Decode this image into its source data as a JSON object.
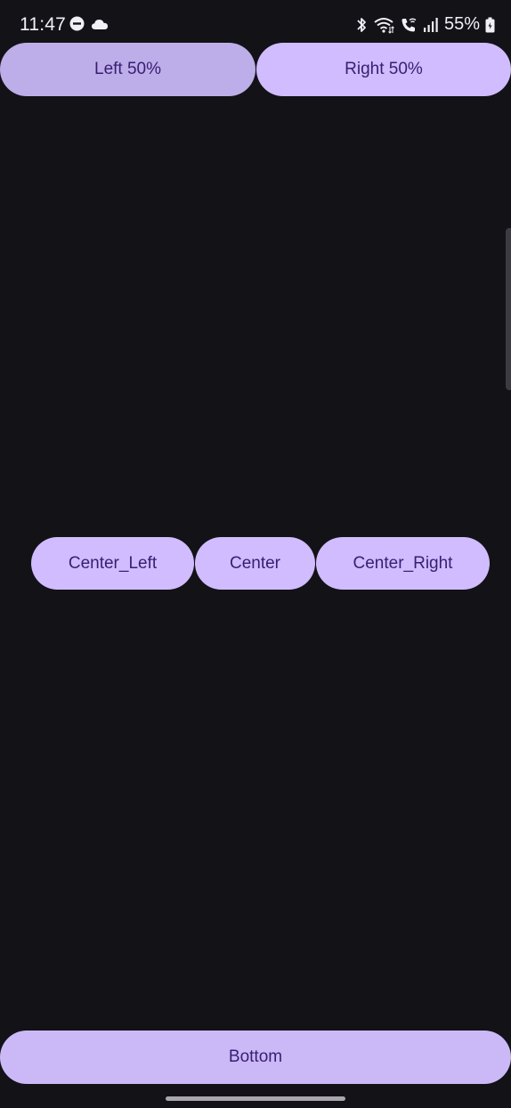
{
  "status_bar": {
    "time": "11:47",
    "battery": "55%",
    "left_icons": [
      "do-not-disturb-icon",
      "cloud-icon"
    ],
    "right_icons": [
      "bluetooth-icon",
      "wifi-icon",
      "wifi-calling-icon",
      "signal-icon",
      "battery-icon"
    ]
  },
  "buttons": {
    "left": "Left 50%",
    "right": "Right 50%",
    "center_left": "Center_Left",
    "center": "Center",
    "center_right": "Center_Right",
    "bottom": "Bottom"
  },
  "colors": {
    "background": "#131217",
    "button_fill": "#d0bcff",
    "button_text": "#381e72",
    "button_pressed": "#bdaee9"
  }
}
